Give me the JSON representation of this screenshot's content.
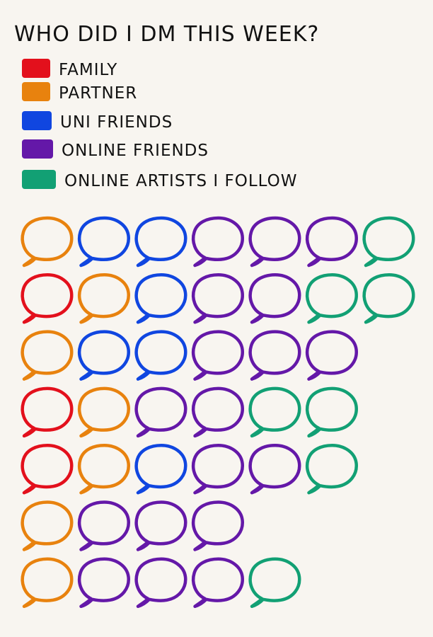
{
  "chart_data": {
    "type": "pictogram",
    "title": "WHO DID I DM THIS WEEK?",
    "legend": [
      {
        "key": "family",
        "label": "FAMILY",
        "color": "#e3101c"
      },
      {
        "key": "partner",
        "label": "PARTNER",
        "color": "#e8820e"
      },
      {
        "key": "uni",
        "label": "UNI FRIENDS",
        "color": "#1046e0"
      },
      {
        "key": "online",
        "label": "ONLINE FRIENDS",
        "color": "#6418a8"
      },
      {
        "key": "artists",
        "label": "ONLINE ARTISTS I FOLLOW",
        "color": "#12a074"
      }
    ],
    "rows": [
      [
        "partner",
        "uni",
        "uni",
        "online",
        "online",
        "online",
        "artists"
      ],
      [
        "family",
        "partner",
        "uni",
        "online",
        "online",
        "artists",
        "artists"
      ],
      [
        "partner",
        "uni",
        "uni",
        "online",
        "online",
        "online"
      ],
      [
        "family",
        "partner",
        "online",
        "online",
        "artists",
        "artists"
      ],
      [
        "family",
        "partner",
        "uni",
        "online",
        "online",
        "artists"
      ],
      [
        "partner",
        "online",
        "online",
        "online"
      ],
      [
        "partner",
        "online",
        "online",
        "online",
        "artists"
      ]
    ],
    "totals": {
      "family": 3,
      "partner": 7,
      "uni": 6,
      "online": 20,
      "artists": 7
    }
  }
}
